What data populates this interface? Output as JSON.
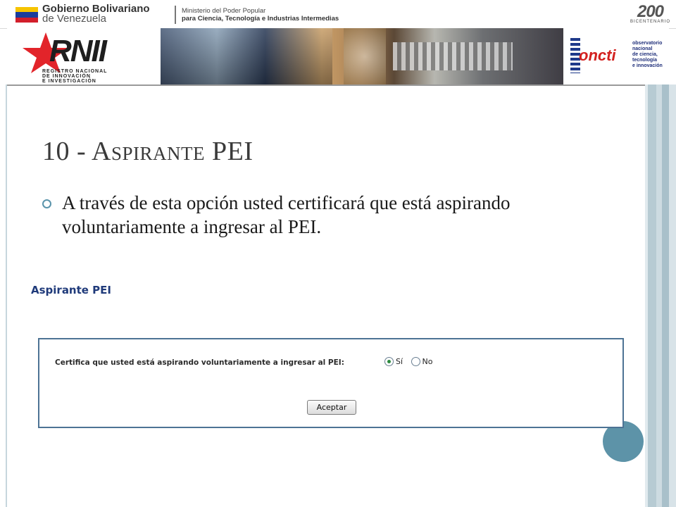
{
  "header": {
    "gov_name_1": "Gobierno Bolivariano",
    "gov_name_2": "de Venezuela",
    "ministry_line1": "Ministerio del Poder Popular",
    "ministry_line2": "para Ciencia, Tecnología e Industrias Intermedias",
    "bicentenario_num": "200",
    "bicentenario_label": "BICENTENARIO"
  },
  "banner": {
    "rni_letters": "RNII",
    "rni_caption": [
      "REGISTRO NACIONAL",
      "DE INNOVACIÓN",
      "E INVESTIGACIÓN"
    ],
    "oncti_word": "oncti",
    "oncti_caption": [
      "observatorio",
      "nacional",
      "de ciencia,",
      "tecnología",
      "e innovación"
    ]
  },
  "slide": {
    "title": "10 - Aspirante PEI",
    "bullet": "A través de esta opción usted certificará que está aspirando voluntariamente a ingresar al PEI."
  },
  "form": {
    "heading": "Aspirante PEI",
    "question": "Certifica que usted está aspirando voluntariamente a ingresar al PEI:",
    "options": [
      {
        "label": "Sí",
        "checked": true
      },
      {
        "label": "No",
        "checked": false
      }
    ],
    "submit_label": "Aceptar"
  },
  "colors": {
    "accent": "#5d93a8",
    "form_border": "#4d7394",
    "heading_blue": "#1f3a7a"
  }
}
